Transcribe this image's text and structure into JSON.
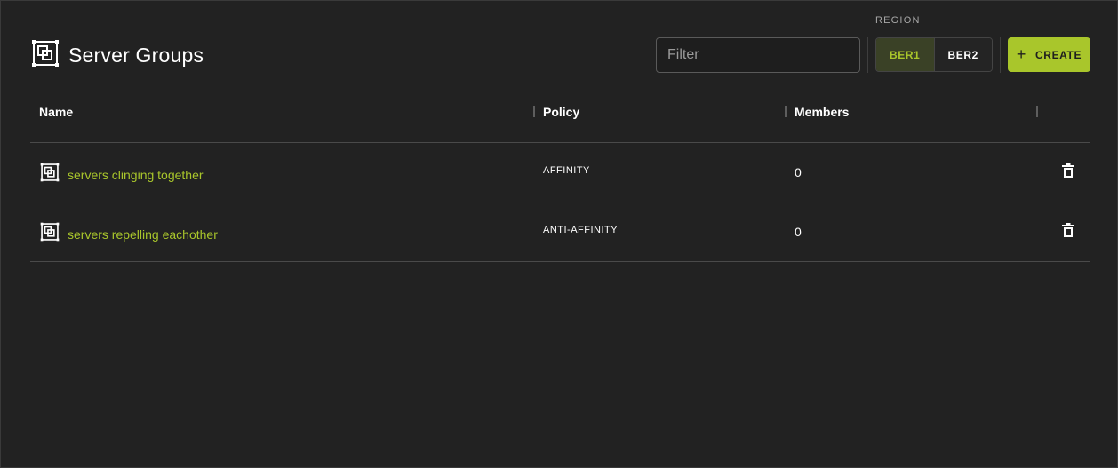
{
  "header": {
    "title": "Server Groups",
    "icon": "server-group-icon",
    "region_label": "REGION",
    "filter_placeholder": "Filter",
    "regions": [
      {
        "label": "BER1",
        "active": true
      },
      {
        "label": "BER2",
        "active": false
      }
    ],
    "create_label": "CREATE"
  },
  "table": {
    "columns": [
      "Name",
      "Policy",
      "Members"
    ],
    "rows": [
      {
        "name": "servers clinging together",
        "policy": "AFFINITY",
        "members": "0"
      },
      {
        "name": "servers repelling eachother",
        "policy": "ANTI-AFFINITY",
        "members": "0"
      }
    ]
  },
  "colors": {
    "background": "#222222",
    "accent": "#a9c62b",
    "border": "#4a4a4a"
  }
}
